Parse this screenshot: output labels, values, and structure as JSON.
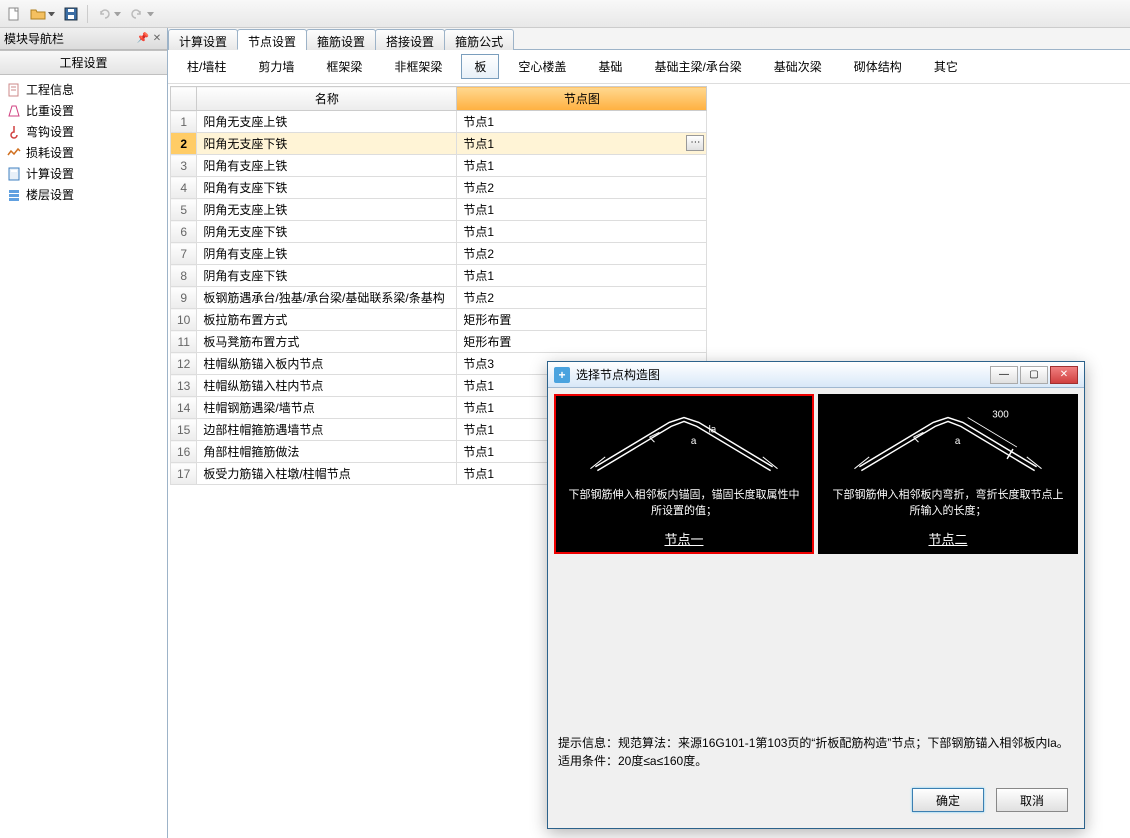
{
  "sidebar": {
    "title": "模块导航栏",
    "section": "工程设置",
    "items": [
      {
        "label": "工程信息",
        "icon": "doc-icon"
      },
      {
        "label": "比重设置",
        "icon": "weight-icon"
      },
      {
        "label": "弯钩设置",
        "icon": "hook-icon"
      },
      {
        "label": "损耗设置",
        "icon": "loss-icon"
      },
      {
        "label": "计算设置",
        "icon": "calc-icon"
      },
      {
        "label": "楼层设置",
        "icon": "floor-icon"
      }
    ]
  },
  "main_tabs": [
    "计算设置",
    "节点设置",
    "箍筋设置",
    "搭接设置",
    "箍筋公式"
  ],
  "active_main_tab": 1,
  "sub_cats": [
    "柱/墙柱",
    "剪力墙",
    "框架梁",
    "非框架梁",
    "板",
    "空心楼盖",
    "基础",
    "基础主梁/承台梁",
    "基础次梁",
    "砌体结构",
    "其它"
  ],
  "active_sub_cat": 4,
  "table": {
    "col_name": "名称",
    "col_node": "节点图",
    "rows": [
      {
        "n": 1,
        "name": "阳角无支座上铁",
        "node": "节点1"
      },
      {
        "n": 2,
        "name": "阳角无支座下铁",
        "node": "节点1"
      },
      {
        "n": 3,
        "name": "阳角有支座上铁",
        "node": "节点1"
      },
      {
        "n": 4,
        "name": "阳角有支座下铁",
        "node": "节点2"
      },
      {
        "n": 5,
        "name": "阴角无支座上铁",
        "node": "节点1"
      },
      {
        "n": 6,
        "name": "阴角无支座下铁",
        "node": "节点1"
      },
      {
        "n": 7,
        "name": "阴角有支座上铁",
        "node": "节点2"
      },
      {
        "n": 8,
        "name": "阴角有支座下铁",
        "node": "节点1"
      },
      {
        "n": 9,
        "name": "板钢筋遇承台/独基/承台梁/基础联系梁/条基构",
        "node": "节点2"
      },
      {
        "n": 10,
        "name": "板拉筋布置方式",
        "node": "矩形布置"
      },
      {
        "n": 11,
        "name": "板马凳筋布置方式",
        "node": "矩形布置"
      },
      {
        "n": 12,
        "name": "柱帽纵筋锚入板内节点",
        "node": "节点3"
      },
      {
        "n": 13,
        "name": "柱帽纵筋锚入柱内节点",
        "node": "节点1"
      },
      {
        "n": 14,
        "name": "柱帽钢筋遇梁/墙节点",
        "node": "节点1"
      },
      {
        "n": 15,
        "name": "边部柱帽箍筋遇墙节点",
        "node": "节点1"
      },
      {
        "n": 16,
        "name": "角部柱帽箍筋做法",
        "node": "节点1"
      },
      {
        "n": 17,
        "name": "板受力筋锚入柱墩/柱帽节点",
        "node": "节点1"
      }
    ],
    "selected_row": 1,
    "cell_btn": "⋯"
  },
  "dialog": {
    "title": "选择节点构造图",
    "option1": {
      "caption": "节点一",
      "desc": "下部钢筋伸入相邻板内锚固，锚固长度取属性中所设置的值；"
    },
    "option2": {
      "caption": "节点二",
      "desc": "下部钢筋伸入相邻板内弯折，弯折长度取节点上所输入的长度；",
      "dim": "300"
    },
    "hint_label": "提示信息：",
    "hint_text": "规范算法：来源16G101-1第103页的“折板配筋构造”节点；下部钢筋锚入相邻板内la。适用条件：20度≤a≤160度。",
    "ok": "确定",
    "cancel": "取消"
  }
}
